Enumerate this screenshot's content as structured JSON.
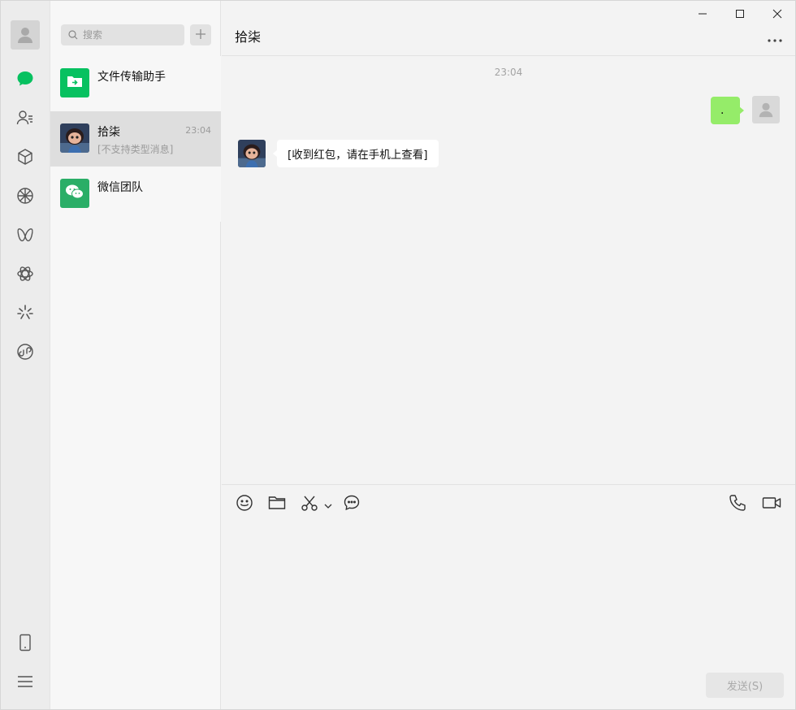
{
  "colors": {
    "brand_green": "#07c160",
    "nav_bg": "#ececec",
    "bubble_out": "#95ec69",
    "bubble_in": "#ffffff"
  },
  "nav": {
    "items": [
      {
        "icon": "chat-icon",
        "active": true
      },
      {
        "icon": "contacts-icon"
      },
      {
        "icon": "favorites-icon"
      },
      {
        "icon": "moments-icon"
      },
      {
        "icon": "channels-icon"
      },
      {
        "icon": "search-miniprogram-icon"
      },
      {
        "icon": "top-stories-icon"
      },
      {
        "icon": "mini-programs-icon"
      }
    ],
    "bottom": [
      {
        "icon": "phone-icon"
      },
      {
        "icon": "menu-icon"
      }
    ]
  },
  "search": {
    "placeholder": "搜索"
  },
  "sessions": [
    {
      "name": "文件传输助手",
      "preview": "",
      "time": ""
    },
    {
      "name": "拾柒",
      "preview": "[不支持类型消息]",
      "time": "23:04"
    },
    {
      "name": "微信团队",
      "preview": "",
      "time": ""
    }
  ],
  "chat": {
    "title": "拾柒",
    "timestamp": "23:04",
    "messages": [
      {
        "side": "out",
        "text": "."
      },
      {
        "side": "in",
        "text": "[收到红包，请在手机上查看]"
      }
    ],
    "send_label": "发送(S)"
  }
}
